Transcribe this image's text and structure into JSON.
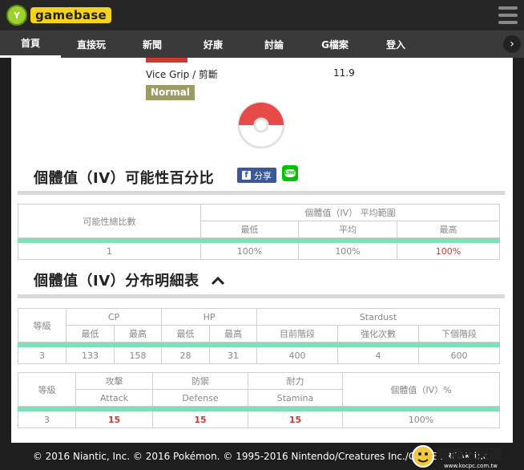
{
  "logo": {
    "text": "gamebase",
    "mark": "Y"
  },
  "nav": {
    "items": [
      {
        "label": "首頁",
        "active": true
      },
      {
        "label": "直接玩"
      },
      {
        "label": "新聞"
      },
      {
        "label": "好康"
      },
      {
        "label": "討論"
      },
      {
        "label": "G檔案"
      },
      {
        "label": "登入"
      }
    ],
    "next_icon": "›"
  },
  "move": {
    "name": "Vice Grip / 剪斷",
    "value": "11.9",
    "type": "Normal"
  },
  "iv_percent": {
    "title": "個體值（IV）可能性百分比",
    "share_label": "分享",
    "line_label": "LINE",
    "headers": {
      "total": "可能性總比數",
      "range": "個體值（IV） 平均範圍",
      "min": "最低",
      "avg": "平均",
      "max": "最高"
    },
    "row": {
      "total": "1",
      "min": "100%",
      "avg": "100%",
      "max": "100%"
    }
  },
  "iv_detail": {
    "title": "個體值（IV）分布明細表",
    "caret": "^",
    "headers": {
      "level": "等級",
      "cp": "CP",
      "hp": "HP",
      "stardust": "Stardust",
      "min": "最低",
      "max": "最高",
      "current": "目前階段",
      "power_ups": "強化次數",
      "next": "下個階段"
    },
    "row": {
      "level": "3",
      "cp_min": "133",
      "cp_max": "158",
      "hp_min": "28",
      "hp_max": "31",
      "current": "400",
      "power_ups": "4",
      "next": "600"
    }
  },
  "iv_stats": {
    "headers": {
      "level": "等級",
      "attack_zh": "攻擊",
      "attack_en": "Attack",
      "defense_zh": "防禦",
      "defense_en": "Defense",
      "stamina_zh": "耐力",
      "stamina_en": "Stamina",
      "iv": "個體值（IV）%"
    },
    "row": {
      "level": "3",
      "attack": "15",
      "defense": "15",
      "stamina": "15",
      "iv": "100%"
    }
  },
  "footer": {
    "text": "© 2016 Niantic, Inc. © 2016 Pokémon. © 1995-2016 Nintendo/Creatures Inc./GAME FREAK inc."
  },
  "watermark": {
    "text": "電腦王阿達",
    "url": "www.kocpc.com.tw"
  },
  "colors": {
    "accent_green": "#7ee0b7",
    "red": "#d0392f",
    "type_normal": "#9b9b63",
    "facebook": "#3b5998",
    "line": "#00c300"
  }
}
